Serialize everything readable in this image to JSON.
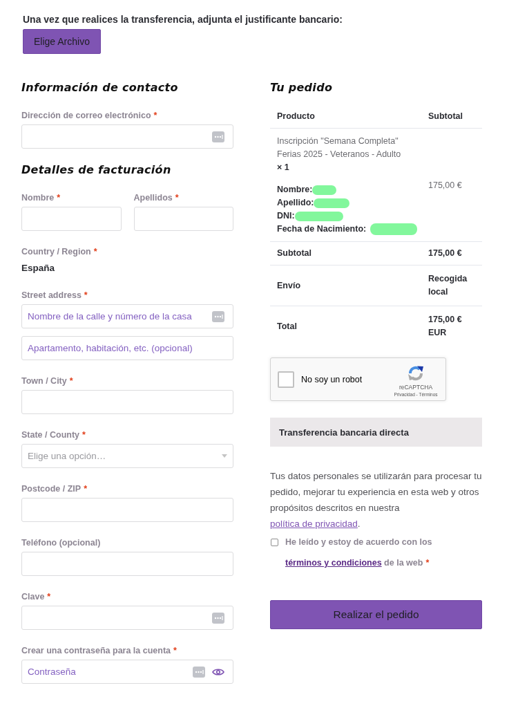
{
  "upload": {
    "instruction": "Una vez que realices la transferencia, adjunta el justificante bancario:",
    "button": "Elige Archivo"
  },
  "checkout_form": {
    "sections": [
      {
        "heading": "Información de contacto",
        "fields": [
          {
            "kind": "input",
            "label": "Dirección de correo electrónico",
            "required_mark": "*",
            "inputs": [
              {
                "autofill_icon": true,
                "reveal_icon": false
              }
            ]
          }
        ]
      },
      {
        "heading": "Detalles de facturación",
        "fields": [
          {
            "kind": "pair",
            "fields": [
              {
                "kind": "input",
                "label": "Nombre",
                "required_mark": "*",
                "inputs": [
                  {
                    "autofill_icon": false,
                    "reveal_icon": false
                  }
                ]
              },
              {
                "kind": "input",
                "label": "Apellidos",
                "required_mark": "*",
                "inputs": [
                  {
                    "autofill_icon": false,
                    "reveal_icon": false
                  }
                ]
              }
            ]
          },
          {
            "kind": "static",
            "label": "Country / Region",
            "required_mark": "*",
            "value": "España"
          },
          {
            "kind": "input",
            "label": "Street address",
            "required_mark": "*",
            "inputs": [
              {
                "placeholder": "Nombre de la calle y número de la casa",
                "autofill_icon": true,
                "reveal_icon": false
              },
              {
                "placeholder": "Apartamento, habitación, etc. (opcional)",
                "autofill_icon": false,
                "reveal_icon": false
              }
            ]
          },
          {
            "kind": "input",
            "label": "Town / City",
            "required_mark": "*",
            "inputs": [
              {
                "autofill_icon": false,
                "reveal_icon": false
              }
            ]
          },
          {
            "kind": "select",
            "label": "State / County",
            "required_mark": "*",
            "placeholder": "Elige una opción…"
          },
          {
            "kind": "input",
            "label": "Postcode / ZIP",
            "required_mark": "*",
            "inputs": [
              {
                "autofill_icon": false,
                "reveal_icon": false
              }
            ]
          },
          {
            "kind": "input",
            "label": "Teléfono (opcional)",
            "inputs": [
              {
                "autofill_icon": false,
                "reveal_icon": false
              }
            ]
          },
          {
            "kind": "input",
            "label": "Clave",
            "required_mark": "*",
            "inputs": [
              {
                "autofill_icon": true,
                "reveal_icon": false
              }
            ]
          },
          {
            "kind": "input",
            "label": "Crear una contraseña para la cuenta",
            "required_mark": "*",
            "inputs": [
              {
                "placeholder": "Contraseña",
                "autofill_icon": true,
                "reveal_icon": true
              }
            ]
          }
        ]
      }
    ]
  },
  "order": {
    "heading": "Tu pedido",
    "columns": [
      "Producto",
      "Subtotal"
    ],
    "items": [
      {
        "name": "Inscripción \"Semana Completa\" Ferias 2025 - Veteranos - Adulto",
        "quantity": "× 1",
        "meta": [
          {
            "label": "Nombre:",
            "redacted": true
          },
          {
            "label": "Apellido:",
            "redacted": true
          },
          {
            "label": "DNI:",
            "redacted": true
          },
          {
            "label": "Fecha de Nacimiento:",
            "redacted": true
          }
        ],
        "subtotal": "175,00 €"
      }
    ],
    "totals": [
      {
        "label": "Subtotal",
        "value": "175,00 €"
      },
      {
        "label": "Envío",
        "value": "Recogida local"
      },
      {
        "label": "Total",
        "value": "175,00 € EUR"
      }
    ]
  },
  "captcha": {
    "checked": false,
    "label": "No soy un robot",
    "brand": "reCAPTCHA",
    "footer": "Privacidad - Términos"
  },
  "payment_methods": [
    {
      "label": "Transferencia bancaria directa",
      "selected": true
    }
  ],
  "privacy_notice": {
    "text": "Tus datos personales se utilizarán para procesar tu pedido, mejorar tu experiencia en esta web y otros propósitos descritos en nuestra",
    "link": "política de privacidad",
    "end": "."
  },
  "terms": {
    "checked": false,
    "text": "He leído y estoy de acuerdo con los",
    "link": "términos y condiciones",
    "end": "de la web",
    "required_mark": "*"
  },
  "place_order": "Realizar el pedido"
}
